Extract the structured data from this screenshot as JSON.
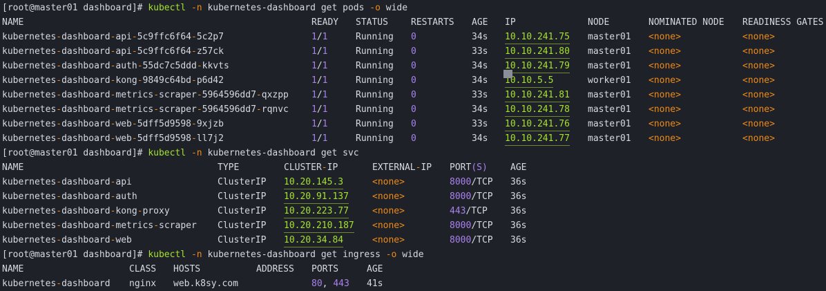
{
  "prompts": [
    {
      "prefix": "[root@master01 dashboard]#",
      "cmd": "kubectl",
      "flag1": "-n",
      "ns": "kubernetes-dashboard",
      "verb": "get pods",
      "flag2": "-o",
      "opt": "wide"
    },
    {
      "prefix": "[root@master01 dashboard]#",
      "cmd": "kubectl",
      "flag1": "-n",
      "ns": "kubernetes-dashboard",
      "verb": "get svc"
    },
    {
      "prefix": "[root@master01 dashboard]#",
      "cmd": "kubectl",
      "flag1": "-n",
      "ns": "kubernetes-dashboard",
      "verb": "get ingress",
      "flag2": "-o",
      "opt": "wide"
    }
  ],
  "pods": {
    "headers": [
      "NAME",
      "READY",
      "STATUS",
      "RESTARTS",
      "AGE",
      "IP",
      "NODE",
      "NOMINATED NODE",
      "READINESS GATES"
    ],
    "rows": [
      [
        "kubernetes-dashboard-api-5c9ffc6f64-5c2p7",
        "1/1",
        "Running",
        "0",
        "34s",
        "10.10.241.75",
        "master01",
        "<none>",
        "<none>"
      ],
      [
        "kubernetes-dashboard-api-5c9ffc6f64-z57ck",
        "1/1",
        "Running",
        "0",
        "33s",
        "10.10.241.80",
        "master01",
        "<none>",
        "<none>"
      ],
      [
        "kubernetes-dashboard-auth-55dc7c5ddd-kkvts",
        "1/1",
        "Running",
        "0",
        "34s",
        "10.10.241.79",
        "master01",
        "<none>",
        "<none>"
      ],
      [
        "kubernetes-dashboard-kong-9849c64bd-p6d42",
        "1/1",
        "Running",
        "0",
        "34s",
        "10.10.5.5",
        "worker01",
        "<none>",
        "<none>"
      ],
      [
        "kubernetes-dashboard-metrics-scraper-5964596dd7-qxzpp",
        "1/1",
        "Running",
        "0",
        "33s",
        "10.10.241.81",
        "master01",
        "<none>",
        "<none>"
      ],
      [
        "kubernetes-dashboard-metrics-scraper-5964596dd7-rqnvc",
        "1/1",
        "Running",
        "0",
        "34s",
        "10.10.241.78",
        "master01",
        "<none>",
        "<none>"
      ],
      [
        "kubernetes-dashboard-web-5dff5d9598-9xjzb",
        "1/1",
        "Running",
        "0",
        "33s",
        "10.10.241.76",
        "master01",
        "<none>",
        "<none>"
      ],
      [
        "kubernetes-dashboard-web-5dff5d9598-ll7j2",
        "1/1",
        "Running",
        "0",
        "34s",
        "10.10.241.77",
        "master01",
        "<none>",
        "<none>"
      ]
    ]
  },
  "svc": {
    "headers": [
      "NAME",
      "TYPE",
      "CLUSTER-IP",
      "EXTERNAL-IP",
      "PORT(S)",
      "AGE"
    ],
    "rows": [
      [
        "kubernetes-dashboard-api",
        "ClusterIP",
        "10.20.145.3",
        "<none>",
        "8000/TCP",
        "36s"
      ],
      [
        "kubernetes-dashboard-auth",
        "ClusterIP",
        "10.20.91.137",
        "<none>",
        "8000/TCP",
        "36s"
      ],
      [
        "kubernetes-dashboard-kong-proxy",
        "ClusterIP",
        "10.20.223.77",
        "<none>",
        "443/TCP",
        "36s"
      ],
      [
        "kubernetes-dashboard-metrics-scraper",
        "ClusterIP",
        "10.20.210.187",
        "<none>",
        "8000/TCP",
        "36s"
      ],
      [
        "kubernetes-dashboard-web",
        "ClusterIP",
        "10.20.34.84",
        "<none>",
        "8000/TCP",
        "36s"
      ]
    ]
  },
  "ingress": {
    "headers": [
      "NAME",
      "CLASS",
      "HOSTS",
      "ADDRESS",
      "PORTS",
      "AGE"
    ],
    "rows": [
      [
        "kubernetes-dashboard",
        "nginx",
        "web.k8sy.com",
        "",
        "80, 443",
        "41s"
      ]
    ]
  },
  "colors": {
    "background": "#1e2127",
    "text": "#d7dae0",
    "green": "#a6e22e",
    "purple": "#a982ef",
    "orange": "#ef8a1a"
  }
}
